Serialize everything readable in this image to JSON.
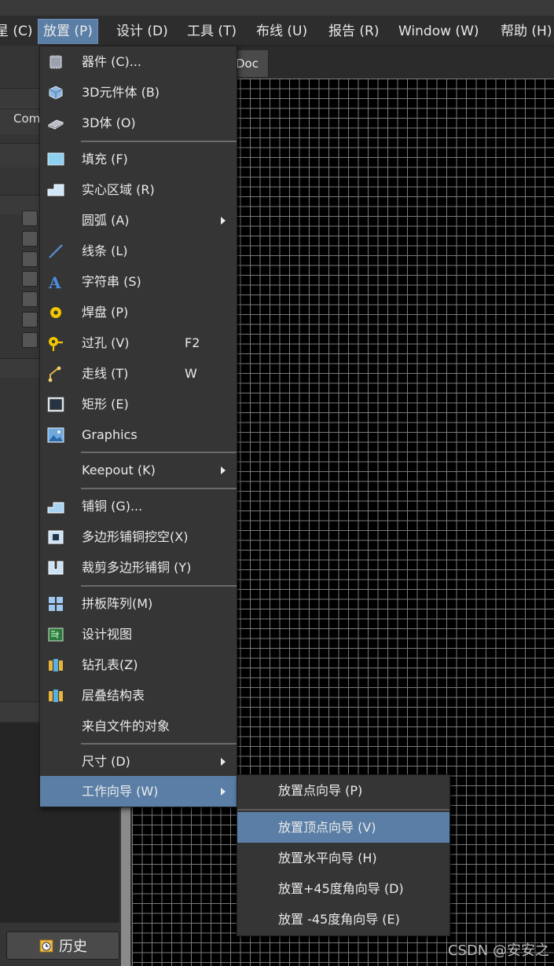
{
  "menubar": {
    "items": [
      {
        "label": "星 (C)"
      },
      {
        "label": "放置 (P)"
      },
      {
        "label": "设计 (D)"
      },
      {
        "label": "工具 (T)"
      },
      {
        "label": "布线 (U)"
      },
      {
        "label": "报告 (R)"
      },
      {
        "label": "Window (W)"
      },
      {
        "label": "帮助 (H)"
      }
    ]
  },
  "left_panel": {
    "column_header": "Com",
    "history_label": "历史"
  },
  "document_tab": "Doc *",
  "watermark": "CSDN @安安之",
  "place_menu": {
    "items": [
      {
        "label": "器件 (C)...",
        "icon": "component-icon"
      },
      {
        "label": "3D元件体 (B)",
        "icon": "3d-component-body-icon"
      },
      {
        "label": "3D体 (O)",
        "icon": "3d-body-icon"
      },
      {
        "label": "填充 (F)",
        "icon": "fill-icon"
      },
      {
        "label": "实心区域 (R)",
        "icon": "solid-region-icon"
      },
      {
        "label": "圆弧 (A)",
        "icon": "",
        "submenu": true
      },
      {
        "label": "线条 (L)",
        "icon": "line-icon"
      },
      {
        "label": "字符串 (S)",
        "icon": "string-icon"
      },
      {
        "label": "焊盘 (P)",
        "icon": "pad-icon"
      },
      {
        "label": "过孔 (V)",
        "icon": "via-icon",
        "shortcut": "F2"
      },
      {
        "label": "走线 (T)",
        "icon": "track-icon",
        "shortcut": "W"
      },
      {
        "label": "矩形 (E)",
        "icon": "rectangle-icon"
      },
      {
        "label": "Graphics",
        "icon": "graphics-icon"
      },
      {
        "label": "Keepout (K)",
        "icon": "",
        "submenu": true
      },
      {
        "label": "铺铜 (G)...",
        "icon": "polygon-pour-icon"
      },
      {
        "label": "多边形铺铜挖空(X)",
        "icon": "polygon-cutout-icon"
      },
      {
        "label": "裁剪多边形铺铜 (Y)",
        "icon": "slice-polygon-icon"
      },
      {
        "label": "拼板阵列(M)",
        "icon": "embedded-board-array-icon"
      },
      {
        "label": "设计视图",
        "icon": "design-view-icon"
      },
      {
        "label": "钻孔表(Z)",
        "icon": "drill-table-icon"
      },
      {
        "label": "层叠结构表",
        "icon": "layer-stack-table-icon"
      },
      {
        "label": "来自文件的对象",
        "icon": ""
      },
      {
        "label": "尺寸 (D)",
        "icon": "",
        "submenu": true
      },
      {
        "label": "工作向导 (W)",
        "icon": "",
        "submenu": true,
        "highlighted": true
      }
    ]
  },
  "work_guide_submenu": {
    "items": [
      {
        "label": "放置点向导 (P)"
      },
      {
        "label": "放置顶点向导 (V)",
        "highlighted": true
      },
      {
        "label": "放置水平向导 (H)"
      },
      {
        "label": "放置+45度角向导 (D)"
      },
      {
        "label": "放置 -45度角向导 (E)"
      }
    ]
  },
  "colors": {
    "highlight": "#5a7ea6",
    "menu_bg": "#353535",
    "canvas_bg": "#000000",
    "grid": "#7a7a7a"
  }
}
